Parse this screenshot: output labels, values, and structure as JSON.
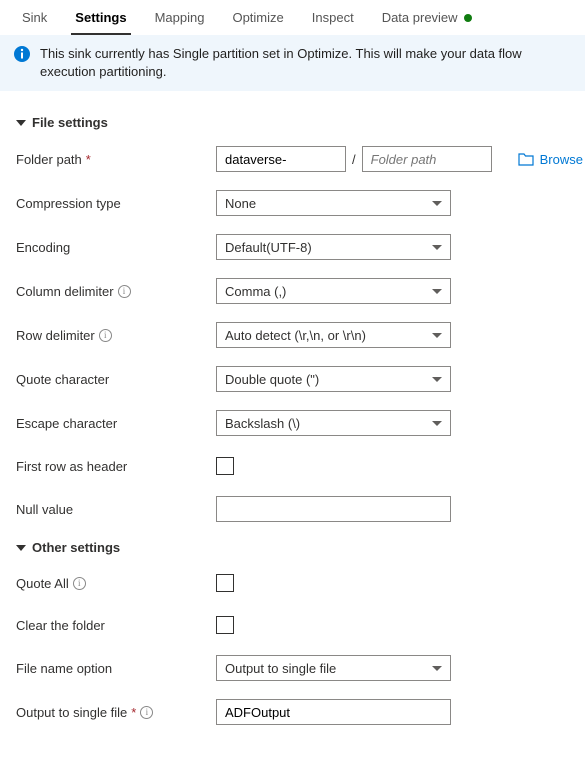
{
  "tabs": {
    "sink": "Sink",
    "settings": "Settings",
    "mapping": "Mapping",
    "optimize": "Optimize",
    "inspect": "Inspect",
    "data_preview": "Data preview"
  },
  "info_bar": "This sink currently has Single partition set in Optimize. This will make your data flow execution partitioning.",
  "sections": {
    "file_settings": "File settings",
    "other_settings": "Other settings"
  },
  "labels": {
    "folder_path": "Folder path",
    "compression_type": "Compression type",
    "encoding": "Encoding",
    "column_delimiter": "Column delimiter",
    "row_delimiter": "Row delimiter",
    "quote_character": "Quote character",
    "escape_character": "Escape character",
    "first_row_header": "First row as header",
    "null_value": "Null value",
    "quote_all": "Quote All",
    "clear_folder": "Clear the folder",
    "file_name_option": "File name option",
    "output_single_file": "Output to single file"
  },
  "values": {
    "folder_container": "dataverse-",
    "folder_path_placeholder": "Folder path",
    "compression_type": "None",
    "encoding": "Default(UTF-8)",
    "column_delimiter": "Comma (,)",
    "row_delimiter": "Auto detect (\\r,\\n, or \\r\\n)",
    "quote_character": "Double quote (\")",
    "escape_character": "Backslash (\\)",
    "file_name_option": "Output to single file",
    "output_single_file": "ADFOutput",
    "null_value": ""
  },
  "actions": {
    "browse": "Browse"
  }
}
